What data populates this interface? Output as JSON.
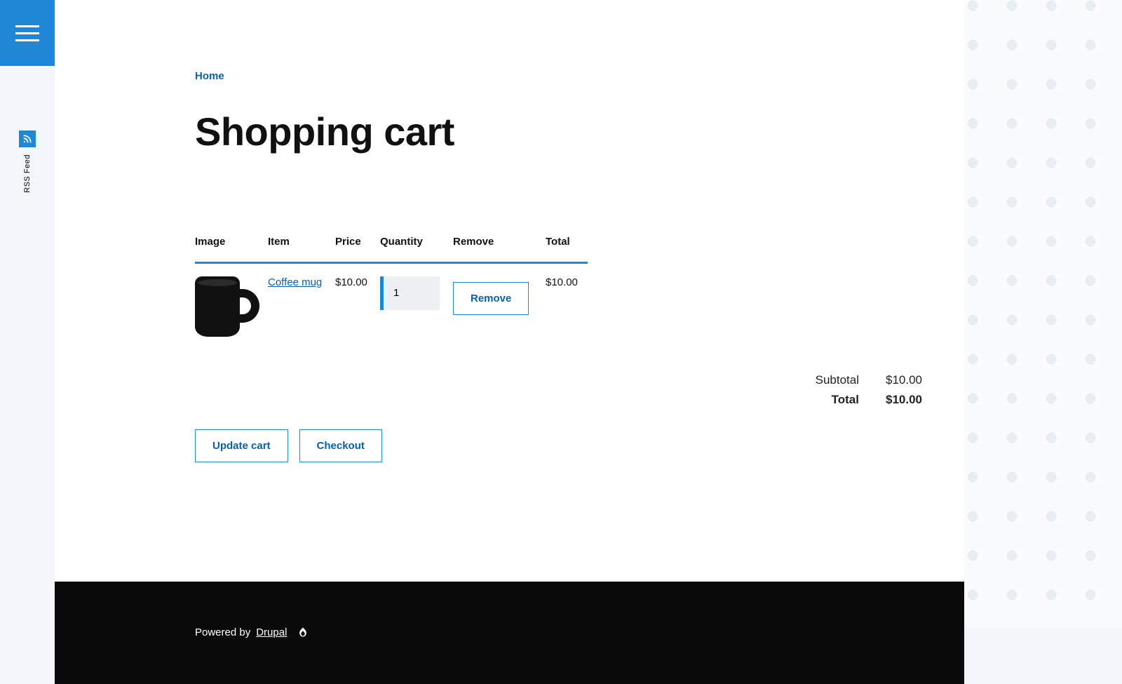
{
  "sidebar": {
    "rss_label": "RSS Feed"
  },
  "breadcrumb": {
    "home": "Home"
  },
  "page": {
    "title": "Shopping cart"
  },
  "cart": {
    "columns": {
      "image": "Image",
      "item": "Item",
      "price": "Price",
      "quantity": "Quantity",
      "remove": "Remove",
      "total": "Total"
    },
    "items": [
      {
        "name": "Coffee mug",
        "price": "$10.00",
        "quantity": "1",
        "line_total": "$10.00",
        "remove_label": "Remove"
      }
    ],
    "actions": {
      "update": "Update cart",
      "checkout": "Checkout"
    }
  },
  "totals": {
    "subtotal_label": "Subtotal",
    "subtotal_value": "$10.00",
    "total_label": "Total",
    "total_value": "$10.00"
  },
  "footer": {
    "powered_by": "Powered by",
    "drupal": "Drupal"
  }
}
